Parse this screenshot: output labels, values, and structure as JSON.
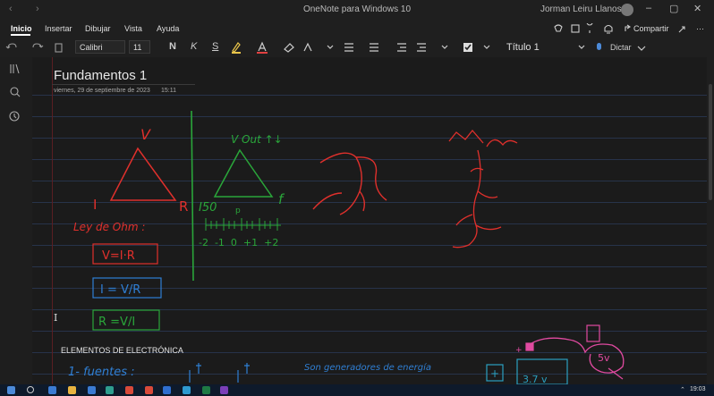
{
  "titlebar": {
    "back": "‹",
    "forward": "›",
    "app_title": "OneNote para Windows 10",
    "user": "Jorman Leiru Llanos...",
    "minimize": "–",
    "maximize": "▢",
    "close": "✕"
  },
  "menu": {
    "items": [
      "Inicio",
      "Insertar",
      "Dibujar",
      "Vista",
      "Ayuda"
    ],
    "active": "Inicio",
    "right": {
      "share": "Compartir",
      "more": "···"
    }
  },
  "ribbon": {
    "font": "Calibri",
    "size": "11",
    "bold": "N",
    "italic": "K",
    "underline": "S",
    "style": "Título 1",
    "dictate": "Dictar"
  },
  "page": {
    "title": "Fundamentos 1",
    "date": "viernes, 29 de septiembre de 2023",
    "time": "15:11",
    "section_heading": "ELEMENTOS DE ELECTRÓNICA"
  },
  "ink": {
    "red_triangle": {
      "top": "V",
      "left": "I",
      "right": "R"
    },
    "green_triangle": {
      "top": "V Out ↑↓",
      "left": "I50",
      "right": "f",
      "small": "p"
    },
    "scale": "-2  -1  0  +1  +2",
    "ohm_label": "Ley de Ohm :",
    "formulas": [
      "V=I·R",
      "I = V/R",
      "R =V/I"
    ],
    "fuentes": "1- fuentes :",
    "fuentes_note": "Son generadores de energía",
    "battery": "3.7 v",
    "plus": "+",
    "battery_5v": "5v"
  },
  "taskbar": {
    "time": "19:03"
  },
  "colors": {
    "ink_red": "#e0302c",
    "ink_green": "#2aa63a",
    "ink_blue": "#2f7fd4",
    "ink_pink": "#e04aa0",
    "ink_teal": "#2aa0c0"
  }
}
